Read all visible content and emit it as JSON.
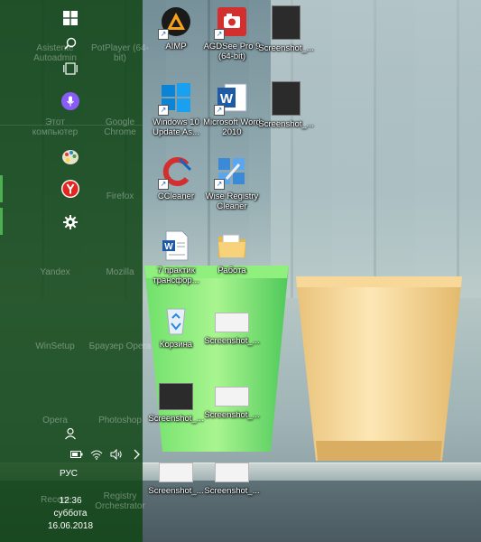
{
  "start_menu": {
    "tray": {
      "icons": [
        "battery-icon",
        "wifi-icon",
        "volume-icon",
        "chevron-right-icon"
      ],
      "language": "РУС"
    },
    "clock": {
      "time": "12:36",
      "day": "суббота",
      "date": "16.06.2018"
    },
    "ghost_tiles": [
      "Asistente Autoadmin",
      "PotPlayer (64-bit)",
      "Этот компьютер",
      "Google Chrome",
      "Firefox",
      "Yandex",
      "Mozilla",
      "WinSetup",
      "Браузер Opera",
      "Opera",
      "Photoshop",
      "Recent",
      "Registry Orchestrator"
    ]
  },
  "desktop": {
    "icons": [
      {
        "label": "AIMP"
      },
      {
        "label": "AGDSee Pro 9 (64-bit)"
      },
      {
        "label": "Screenshot_..."
      },
      {
        "label": "Windows 10 Update As..."
      },
      {
        "label": "Microsoft Word 2010"
      },
      {
        "label": "Screenshot_..."
      },
      {
        "label": "CCleaner"
      },
      {
        "label": "Wise Registry Cleaner"
      },
      {
        "label": "7 практик трансфор..."
      },
      {
        "label": "Работа"
      },
      {
        "label": "Корзина"
      },
      {
        "label": "Screenshot_..."
      },
      {
        "label": "Screenshot_..."
      },
      {
        "label": "Screenshot_..."
      },
      {
        "label": "Screenshot_..."
      },
      {
        "label": "Screenshot_..."
      }
    ]
  },
  "colors": {
    "start_panel": "#124616",
    "accent": "#4caf50"
  }
}
